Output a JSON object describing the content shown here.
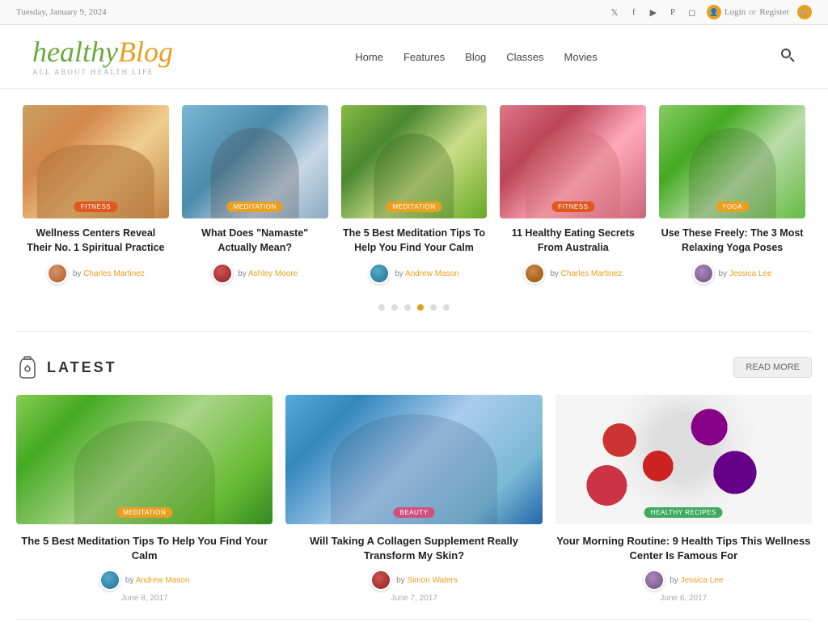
{
  "topbar": {
    "date": "Tuesday, January 9, 2024",
    "login": "Login",
    "or": "or",
    "register": "Register",
    "social": [
      "𝕏",
      "f",
      "▶",
      "P",
      "📷"
    ]
  },
  "header": {
    "logo_healthy": "healthy",
    "logo_blog": "Blog",
    "tagline": "ALL ABOUT HEALTH LIFE",
    "nav": [
      "Home",
      "Features",
      "Blog",
      "Classes",
      "Movies"
    ]
  },
  "featured": {
    "cards": [
      {
        "category": "FITNESS",
        "category_class": "fitness",
        "title": "Wellness Centers Reveal Their No. 1 Spiritual Practice",
        "author_name": "Charles Martinez",
        "avatar_class": "avatar-1"
      },
      {
        "category": "MEDITATION",
        "category_class": "meditation",
        "title": "What Does \"Namaste\" Actually Mean?",
        "author_name": "Ashley Moore",
        "avatar_class": "avatar-2"
      },
      {
        "category": "MEDITATION",
        "category_class": "meditation",
        "title": "The 5 Best Meditation Tips To Help You Find Your Calm",
        "author_name": "Andrew Mason",
        "avatar_class": "avatar-3"
      },
      {
        "category": "FITNESS",
        "category_class": "fitness",
        "title": "11 Healthy Eating Secrets From Australia",
        "author_name": "Charles Martinez",
        "avatar_class": "avatar-4"
      },
      {
        "category": "YOGA",
        "category_class": "yoga",
        "title": "Use These Freely: The 3 Most Relaxing Yoga Poses",
        "author_name": "Jessica Lee",
        "avatar_class": "avatar-5"
      }
    ],
    "img_classes": [
      "img-massage",
      "img-namaste",
      "img-meditation",
      "img-eating",
      "img-yoga"
    ],
    "dots": [
      1,
      2,
      3,
      4,
      5,
      6
    ],
    "active_dot": 4
  },
  "latest": {
    "title": "LATEST",
    "read_more": "READ MORE",
    "cards": [
      {
        "category": "MEDITATION",
        "category_class": "meditation",
        "title": "The 5 Best Meditation Tips To Help You Find Your Calm",
        "author_name": "Andrew Mason",
        "date": "June 8, 2017",
        "avatar_class": "avatar-3",
        "img_class": "img-meditation2"
      },
      {
        "category": "BEAUTY",
        "category_class": "beauty",
        "title": "Will Taking A Collagen Supplement Really Transform My Skin?",
        "author_name": "Simon Waters",
        "date": "June 7, 2017",
        "avatar_class": "avatar-2",
        "img_class": "img-collagen"
      },
      {
        "category": "HEALTHY RECIPES",
        "category_class": "recipes",
        "title": "Your Morning Routine: 9 Health Tips This Wellness Center Is Famous For",
        "author_name": "Jessica Lee",
        "date": "June 6, 2017",
        "avatar_class": "avatar-5",
        "img_class": "img-berries"
      }
    ]
  }
}
